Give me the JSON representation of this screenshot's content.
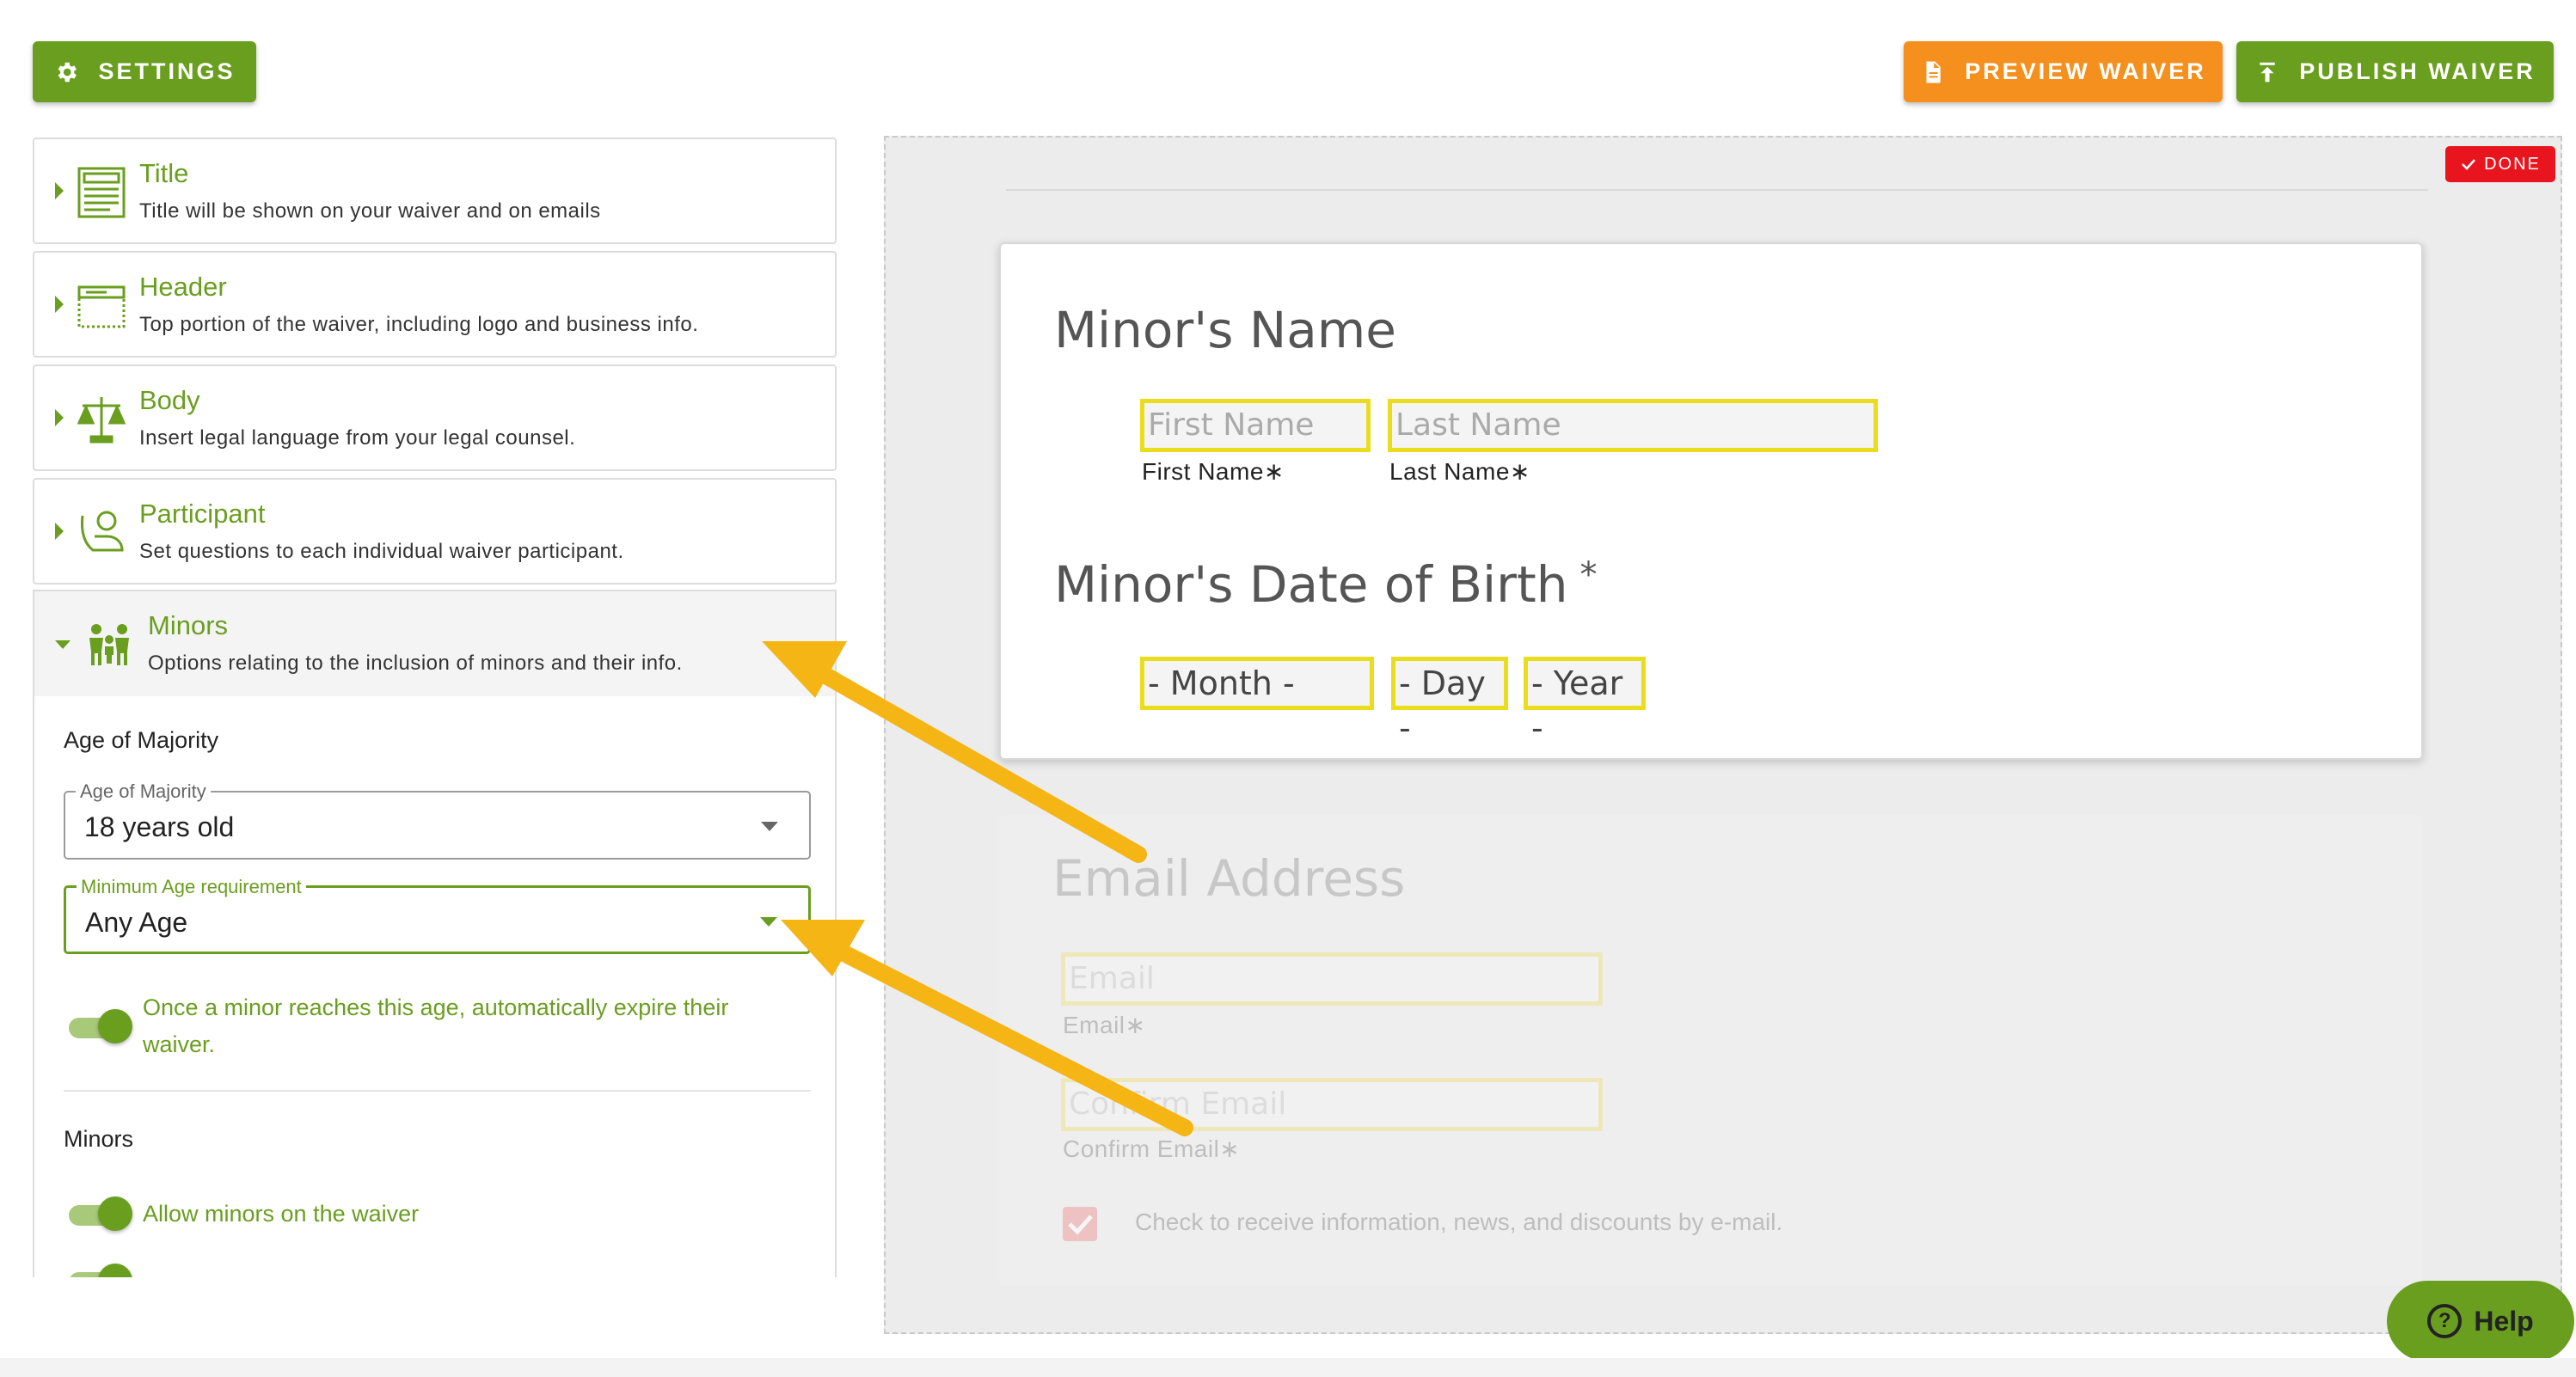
{
  "toolbar": {
    "settings_label": "SETTINGS",
    "preview_label": "PREVIEW WAIVER",
    "publish_label": "PUBLISH WAIVER"
  },
  "sections": [
    {
      "title": "Title",
      "description": "Title will be shown on your waiver and on emails"
    },
    {
      "title": "Header",
      "description": "Top portion of the waiver, including logo and business info."
    },
    {
      "title": "Body",
      "description": "Insert legal language from your legal counsel."
    },
    {
      "title": "Participant",
      "description": "Set questions to each individual waiver participant."
    }
  ],
  "minors": {
    "title": "Minors",
    "description": "Options relating to the inclusion of minors and their info.",
    "age_heading": "Age of Majority",
    "age_field": {
      "label": "Age of Majority",
      "value": "18 years old"
    },
    "min_age_field": {
      "label": "Minimum Age requirement",
      "value": "Any Age"
    },
    "expire_toggle_label_1": "Once a minor reaches this age, automatically expire their",
    "expire_toggle_label_2": "waiver.",
    "minors_heading": "Minors",
    "allow_toggle_label": "Allow minors on the waiver"
  },
  "canvas": {
    "done_label": "DONE",
    "minor_name_heading": "Minor's Name",
    "first_name_placeholder": "First Name",
    "last_name_placeholder": "Last Name",
    "first_name_caption": "First Name∗",
    "last_name_caption": "Last Name∗",
    "dob_heading": "Minor's Date of Birth",
    "dob_required": "*",
    "month_value": "- Month -",
    "day_value": "- Day -",
    "year_value": "- Year -",
    "email_heading": "Email Address",
    "email_placeholder": "Email",
    "email_caption": "Email∗",
    "confirm_placeholder": "Confirm Email",
    "confirm_caption": "Confirm Email∗",
    "optin_label": "Check to receive information, news, and discounts by e-mail."
  },
  "help_label": "Help",
  "colors": {
    "brand_green": "#6a9e1f",
    "preview_orange": "#f5901e",
    "done_red": "#e8151f",
    "field_yellow": "#eadd1e",
    "arrow": "#f5b514"
  }
}
